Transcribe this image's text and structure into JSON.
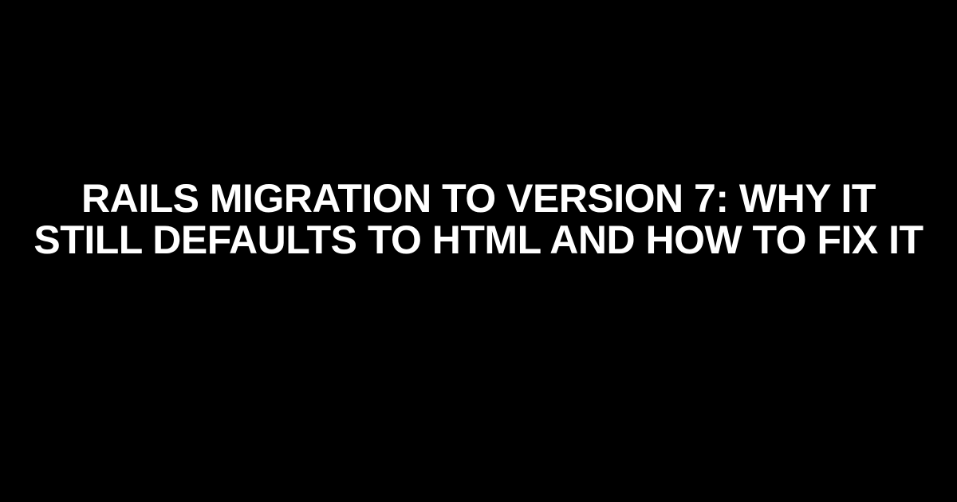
{
  "title": "RAILS MIGRATION TO VERSION 7: WHY IT STILL DEFAULTS TO HTML AND HOW TO FIX IT"
}
